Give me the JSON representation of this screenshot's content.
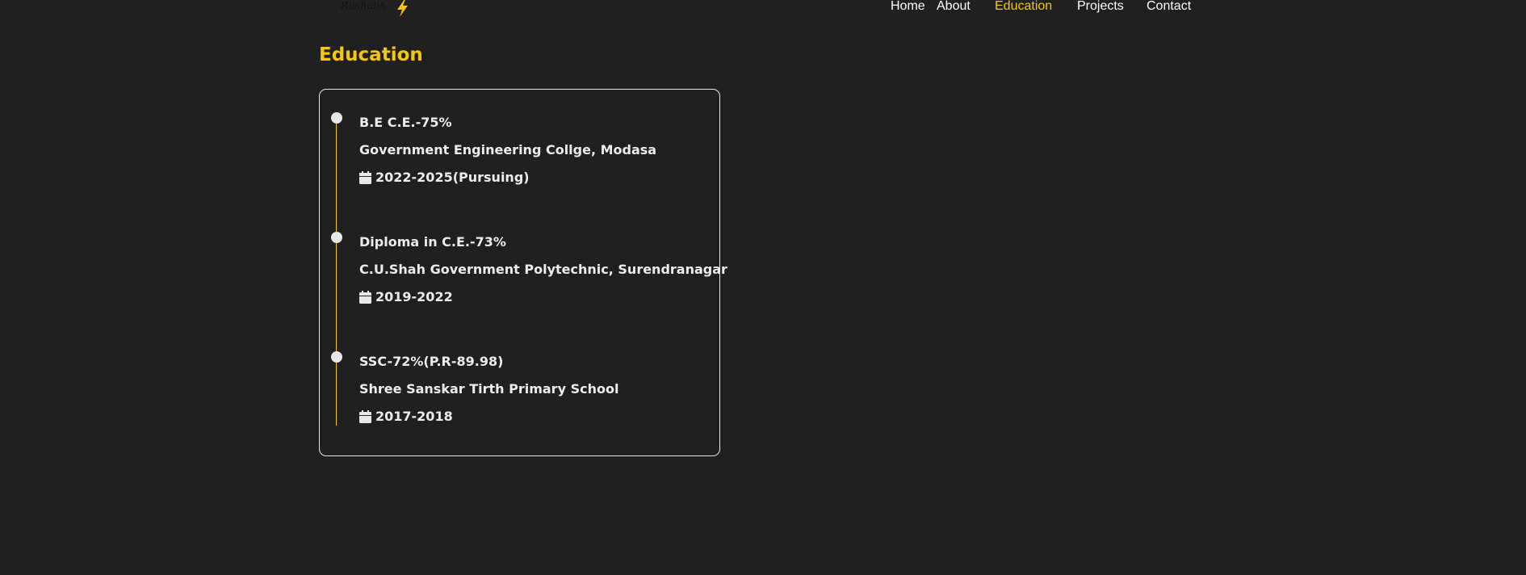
{
  "header": {
    "brand": "Rushabh",
    "nav": [
      {
        "label": "Home",
        "active": false
      },
      {
        "label": "About",
        "active": false
      },
      {
        "label": "Education",
        "active": true
      },
      {
        "label": "Projects",
        "active": false
      },
      {
        "label": "Contact",
        "active": false
      }
    ]
  },
  "section": {
    "title": "Education"
  },
  "education": [
    {
      "degree": "B.E C.E.-75%",
      "institution": "Government Engineering Collge, Modasa",
      "years": "2022-2025(Pursuing)"
    },
    {
      "degree": "Diploma in C.E.-73%",
      "institution": "C.U.Shah Government Polytechnic, Surendranagar",
      "years": "2019-2022"
    },
    {
      "degree": "SSC-72%(P.R-89.98)",
      "institution": "Shree Sanskar Tirth Primary School",
      "years": "2017-2018"
    }
  ],
  "colors": {
    "background": "#202020",
    "accent": "#f5c70a",
    "text": "#ececec"
  },
  "icons": {
    "brand_mark": "lightning-bolt-icon",
    "date": "calendar-icon"
  }
}
